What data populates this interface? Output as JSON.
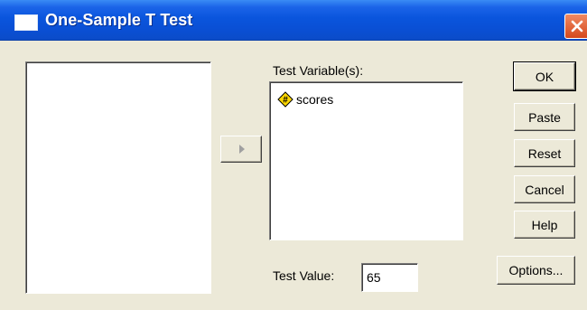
{
  "window": {
    "title": "One-Sample T Test"
  },
  "source_list": {
    "items": []
  },
  "test_variables": {
    "label": "Test Variable(s):",
    "items": [
      {
        "name": "scores",
        "icon": "scale-variable-icon"
      }
    ]
  },
  "test_value": {
    "label": "Test Value:",
    "value": "65"
  },
  "buttons": {
    "ok": "OK",
    "paste": "Paste",
    "reset": "Reset",
    "cancel": "Cancel",
    "help": "Help",
    "options": "Options..."
  },
  "colors": {
    "titlebar": "#0A55DD",
    "dialog_bg": "#ECE9D8",
    "close_button": "#D6481C",
    "variable_icon": "#FFD800"
  }
}
